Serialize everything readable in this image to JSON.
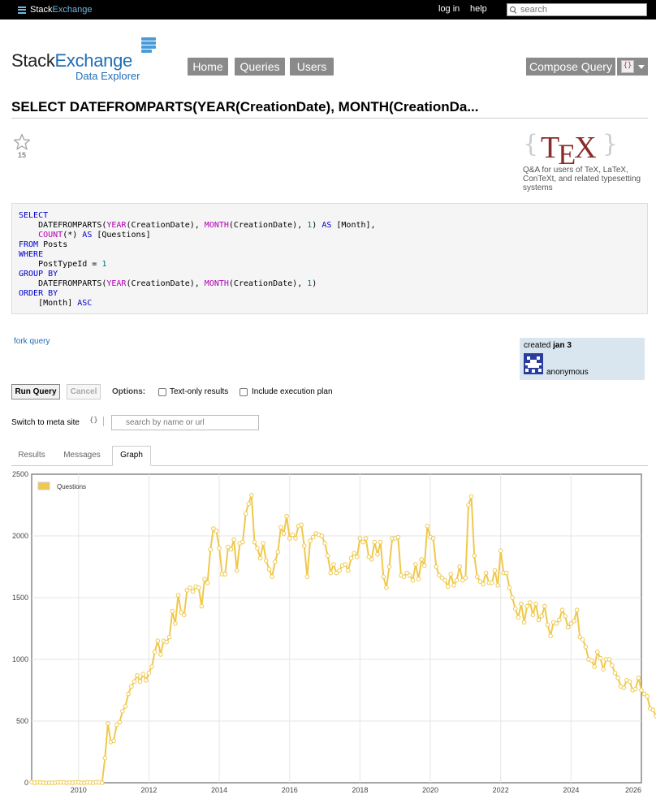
{
  "topbar": {
    "brand_part1": "Stack",
    "brand_part2": "Exchange",
    "login": "log in",
    "help": "help",
    "search_placeholder": "search"
  },
  "logo": {
    "part1": "Stack",
    "part2": "Exchange",
    "subtitle": "Data Explorer"
  },
  "nav": {
    "items": [
      "Home",
      "Queries",
      "Users"
    ],
    "compose": "Compose Query",
    "menu_icon": "sql-icon"
  },
  "query": {
    "title": "SELECT DATEFROMPARTS(YEAR(CreationDate), MONTH(CreationDa...",
    "favorites": "15"
  },
  "site": {
    "name": "TeX",
    "logo_text_a": "T",
    "logo_text_b": "E",
    "logo_text_c": "X",
    "description": "Q&A for users of TeX, LaTeX, ConTeXt, and related typesetting systems"
  },
  "sql_lines": [
    [
      {
        "t": "SELECT",
        "c": "kw"
      }
    ],
    [
      {
        "t": "    DATEFROMPARTS(",
        "c": ""
      },
      {
        "t": "YEAR",
        "c": "fn"
      },
      {
        "t": "(CreationDate), ",
        "c": ""
      },
      {
        "t": "MONTH",
        "c": "fn"
      },
      {
        "t": "(CreationDate), ",
        "c": ""
      },
      {
        "t": "1",
        "c": "num"
      },
      {
        "t": ") ",
        "c": ""
      },
      {
        "t": "AS",
        "c": "kw"
      },
      {
        "t": " [Month],",
        "c": ""
      }
    ],
    [
      {
        "t": "    ",
        "c": ""
      },
      {
        "t": "COUNT",
        "c": "fn"
      },
      {
        "t": "(*) ",
        "c": ""
      },
      {
        "t": "AS",
        "c": "kw"
      },
      {
        "t": " [Questions]",
        "c": ""
      }
    ],
    [
      {
        "t": "FROM",
        "c": "kw"
      },
      {
        "t": " Posts",
        "c": ""
      }
    ],
    [
      {
        "t": "WHERE",
        "c": "kw"
      }
    ],
    [
      {
        "t": "    PostTypeId = ",
        "c": ""
      },
      {
        "t": "1",
        "c": "num"
      }
    ],
    [
      {
        "t": "GROUP BY",
        "c": "kw"
      }
    ],
    [
      {
        "t": "    DATEFROMPARTS(",
        "c": ""
      },
      {
        "t": "YEAR",
        "c": "fn"
      },
      {
        "t": "(CreationDate), ",
        "c": ""
      },
      {
        "t": "MONTH",
        "c": "fn"
      },
      {
        "t": "(CreationDate), ",
        "c": ""
      },
      {
        "t": "1",
        "c": "num"
      },
      {
        "t": ")",
        "c": ""
      }
    ],
    [
      {
        "t": "ORDER BY",
        "c": "kw"
      }
    ],
    [
      {
        "t": "    [Month] ",
        "c": ""
      },
      {
        "t": "ASC",
        "c": "kw"
      }
    ]
  ],
  "actions": {
    "fork": "fork query",
    "created_prefix": "created",
    "created_date": "jan 3",
    "author": "anonymous"
  },
  "run": {
    "run_label": "Run Query",
    "cancel_label": "Cancel",
    "options_label": "Options:",
    "opt_text_only": "Text-only results",
    "opt_exec_plan": "Include execution plan",
    "text_only_checked": false,
    "exec_plan_checked": false
  },
  "meta": {
    "label": "Switch to meta site",
    "icon": "{}",
    "search_placeholder": "search by name or url"
  },
  "tabs": {
    "results": "Results",
    "messages": "Messages",
    "graph": "Graph",
    "active": "graph"
  },
  "colors": {
    "series": "#efc94c",
    "link": "#1f6eb5",
    "nav_button": "#8a8a8a"
  },
  "chart_data": {
    "type": "line",
    "title": "",
    "xlabel": "",
    "ylabel": "",
    "x_start": "2008-09",
    "x_step": "month",
    "x_ticks": [
      "2010",
      "2012",
      "2014",
      "2016",
      "2018",
      "2020",
      "2022",
      "2024",
      "2026"
    ],
    "y_ticks": [
      "0",
      "500",
      "1000",
      "1500",
      "2000",
      "2500"
    ],
    "xlim": [
      "2008-09",
      "2026-01"
    ],
    "ylim": [
      0,
      2500
    ],
    "grid": true,
    "legend_position": "top-left",
    "series": [
      {
        "name": "Questions",
        "color": "#efc94c",
        "values": [
          5,
          0,
          3,
          2,
          0,
          0,
          0,
          0,
          0,
          4,
          3,
          2,
          0,
          2,
          0,
          4,
          3,
          0,
          0,
          3,
          2,
          0,
          5,
          3,
          0,
          200,
          480,
          330,
          340,
          470,
          490,
          580,
          620,
          720,
          780,
          820,
          870,
          820,
          880,
          830,
          890,
          940,
          1060,
          1150,
          1040,
          1150,
          1140,
          1180,
          1390,
          1290,
          1520,
          1380,
          1360,
          1560,
          1580,
          1550,
          1590,
          1580,
          1430,
          1650,
          1620,
          1890,
          2060,
          2040,
          1900,
          1690,
          1690,
          1910,
          1890,
          1970,
          1720,
          1940,
          1950,
          2180,
          2260,
          2330,
          1950,
          1900,
          1820,
          1940,
          1800,
          1730,
          1670,
          1790,
          1870,
          2070,
          2020,
          2160,
          1980,
          2010,
          1980,
          2080,
          2090,
          1920,
          1670,
          1960,
          1990,
          2020,
          2010,
          2000,
          1940,
          1840,
          1700,
          1770,
          1700,
          1720,
          1760,
          1770,
          1720,
          1820,
          1860,
          1830,
          1980,
          1950,
          1980,
          1830,
          1810,
          1950,
          1850,
          1950,
          1670,
          1580,
          1750,
          1980,
          1980,
          1990,
          1680,
          1670,
          1700,
          1680,
          1640,
          1770,
          1650,
          1810,
          1760,
          2080,
          1990,
          1980,
          1750,
          1680,
          1660,
          1640,
          1590,
          1690,
          1600,
          1640,
          1750,
          1640,
          1660,
          2250,
          2320,
          1840,
          1670,
          1630,
          1610,
          1700,
          1620,
          1620,
          1720,
          1600,
          1880,
          1700,
          1700,
          1580,
          1500,
          1410,
          1340,
          1450,
          1300,
          1430,
          1460,
          1360,
          1450,
          1320,
          1350,
          1430,
          1280,
          1190,
          1300,
          1290,
          1320,
          1400,
          1350,
          1260,
          1290,
          1310,
          1400,
          1180,
          1160,
          1100,
          1000,
          990,
          940,
          1060,
          1010,
          920,
          1000,
          1000,
          950,
          890,
          850,
          780,
          770,
          830,
          820,
          750,
          760,
          850,
          750,
          720,
          700,
          600,
          590,
          540,
          500,
          520,
          500,
          490,
          390,
          460
        ]
      }
    ]
  }
}
